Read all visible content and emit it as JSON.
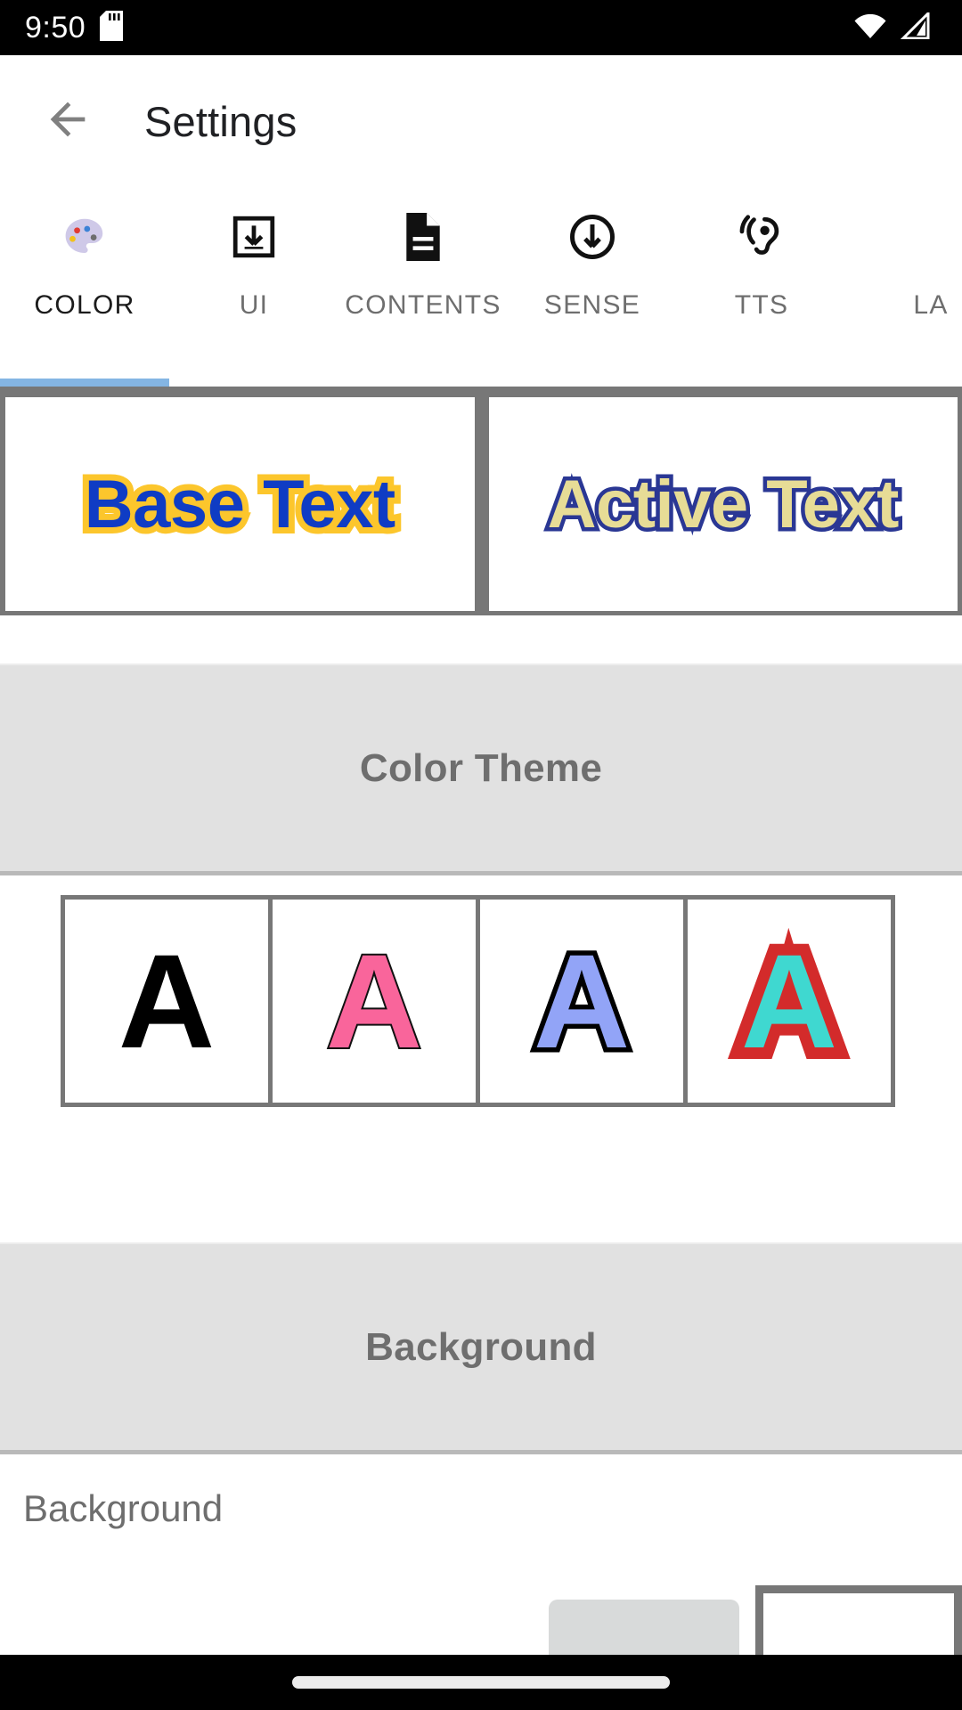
{
  "status_bar": {
    "clock": "9:50",
    "icons": [
      "sd-card-icon",
      "wifi-icon",
      "cellular-signal-icon"
    ]
  },
  "app_bar": {
    "back_icon": "back-arrow-icon",
    "title": "Settings"
  },
  "tabs": {
    "active_index": 0,
    "items": [
      {
        "label": "COLOR",
        "icon": "palette-icon",
        "active": true
      },
      {
        "label": "UI",
        "icon": "download-box-icon",
        "active": false
      },
      {
        "label": "CONTENTS",
        "icon": "document-icon",
        "active": false
      },
      {
        "label": "SENSE",
        "icon": "circle-down-arrow-icon",
        "active": false
      },
      {
        "label": "TTS",
        "icon": "hearing-ear-icon",
        "active": false
      },
      {
        "label": "LA",
        "icon": "",
        "active": false
      }
    ]
  },
  "preview": {
    "base": {
      "text": "Base Text",
      "fill_color": "#0f3cc4",
      "stroke_color": "#fcc62c"
    },
    "active": {
      "text": "Active Text",
      "fill_color": "#e7dc96",
      "stroke_color": "#2a3794"
    }
  },
  "sections": {
    "color_theme": {
      "title": "Color Theme",
      "swatches": [
        {
          "glyph": "A",
          "name": "theme-black",
          "fill": "#000000",
          "stroke": "#000000"
        },
        {
          "glyph": "A",
          "name": "theme-pink",
          "fill": "#f9659b",
          "stroke": "#111111"
        },
        {
          "glyph": "A",
          "name": "theme-blue",
          "fill": "#92a4f7",
          "stroke": "#000000"
        },
        {
          "glyph": "A",
          "name": "theme-teal",
          "fill": "#3fd8d0",
          "stroke": "#d32b2b"
        }
      ]
    },
    "background": {
      "title": "Background",
      "row_label": "Background"
    }
  },
  "nav_bar": {
    "handle": "home-gesture-pill"
  },
  "colors": {
    "accent_indicator": "#84b5e3",
    "band_background": "#e1e1e1",
    "border_gray": "#777777",
    "muted_text": "#6e6e6e"
  }
}
